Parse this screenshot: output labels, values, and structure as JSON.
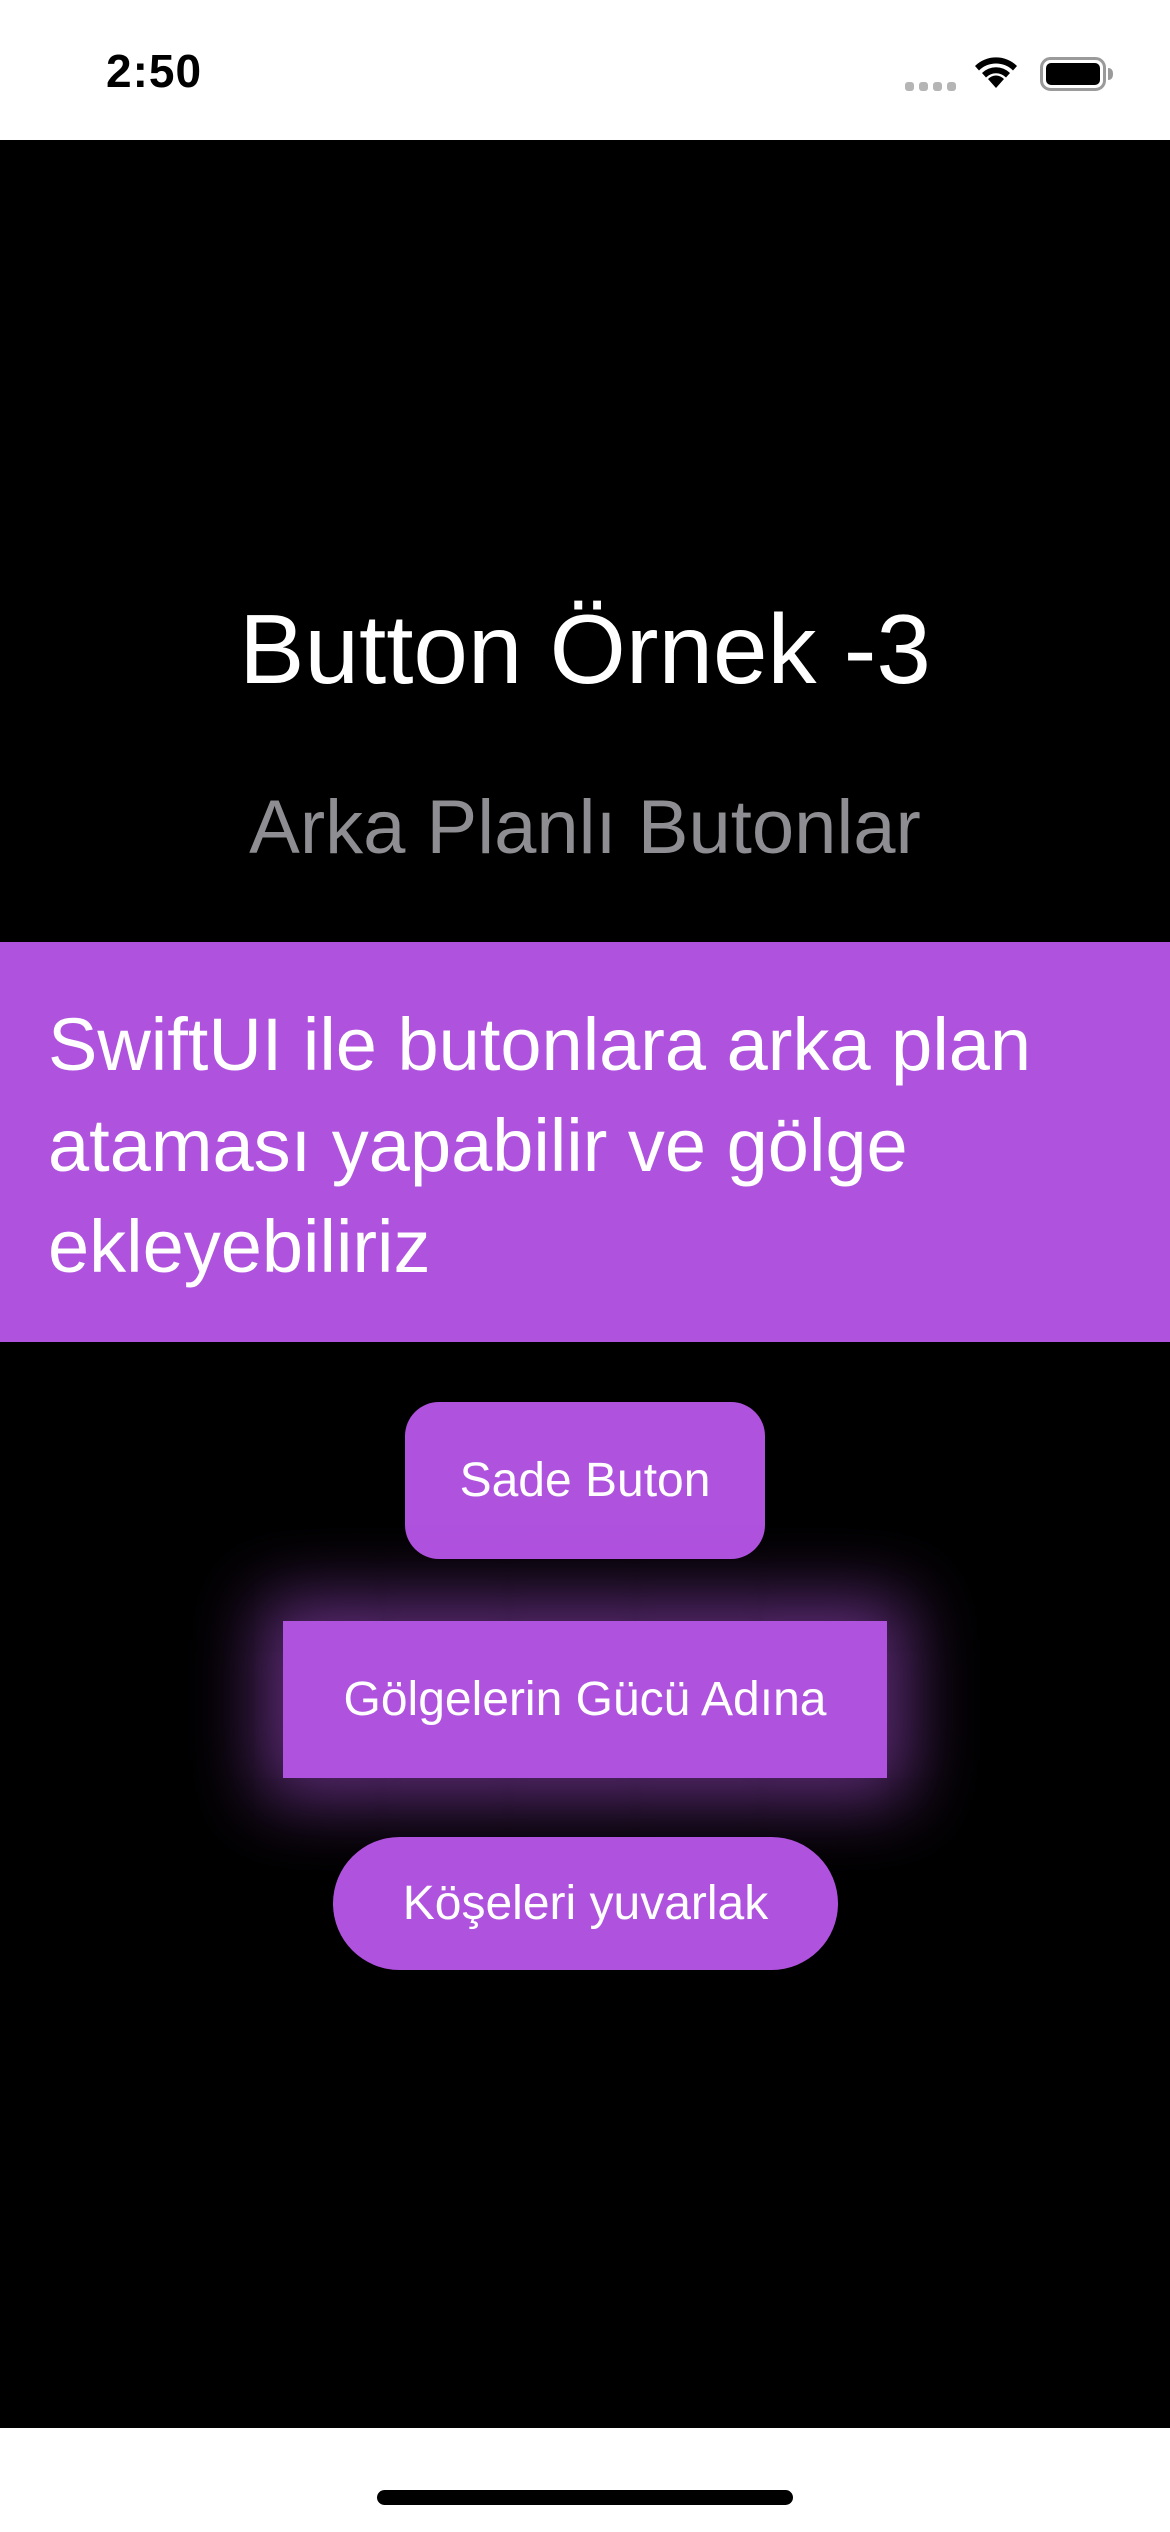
{
  "status_bar": {
    "time": "2:50"
  },
  "header": {
    "title": "Button Örnek -3",
    "subtitle": "Arka Planlı Butonlar"
  },
  "banner": {
    "text": "SwiftUI ile butonlara arka plan ataması yapabilir ve gölge ekleyebiliriz"
  },
  "buttons": {
    "plain_label": "Sade Buton",
    "shadow_label": "Gölgelerin Gücü Adına",
    "rounded_label": "Köşeleri yuvarlak"
  },
  "colors": {
    "accent": "#af52de",
    "background": "#000000",
    "subtitle": "#8d8d92"
  },
  "icons": [
    "cellular-signal-icon",
    "wifi-icon",
    "battery-icon"
  ]
}
